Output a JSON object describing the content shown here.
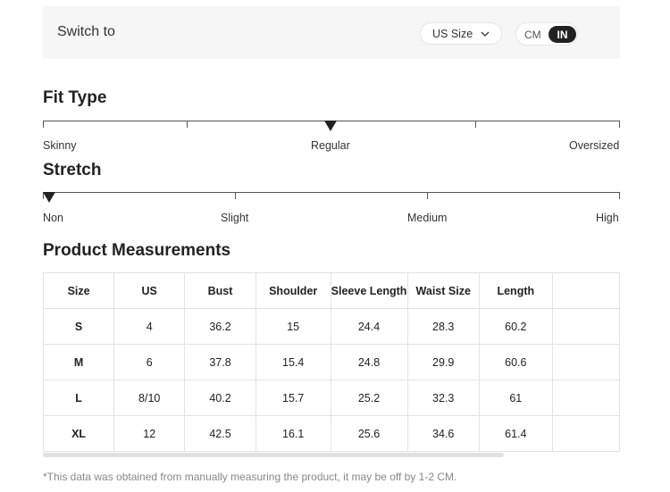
{
  "switch": {
    "label": "Switch to",
    "size_select": "US Size",
    "units": {
      "cm": "CM",
      "in": "IN",
      "selected": "IN"
    }
  },
  "fit_type": {
    "title": "Fit Type",
    "labels": [
      "Skinny",
      "Regular",
      "Oversized"
    ],
    "selected": "Regular"
  },
  "stretch": {
    "title": "Stretch",
    "labels": [
      "Non",
      "Slight",
      "Medium",
      "High"
    ],
    "selected": "Non"
  },
  "measurements": {
    "title": "Product Measurements",
    "headers": [
      "Size",
      "US",
      "Bust",
      "Shoulder",
      "Sleeve Length",
      "Waist Size",
      "Length"
    ],
    "rows": [
      [
        "S",
        "4",
        "36.2",
        "15",
        "24.4",
        "28.3",
        "60.2"
      ],
      [
        "M",
        "6",
        "37.8",
        "15.4",
        "24.8",
        "29.9",
        "60.6"
      ],
      [
        "L",
        "8/10",
        "40.2",
        "15.7",
        "25.2",
        "32.3",
        "61"
      ],
      [
        "XL",
        "12",
        "42.5",
        "16.1",
        "25.6",
        "34.6",
        "61.4"
      ]
    ],
    "note": "*This data was obtained from manually measuring the product, it may be off by 1-2 CM."
  }
}
